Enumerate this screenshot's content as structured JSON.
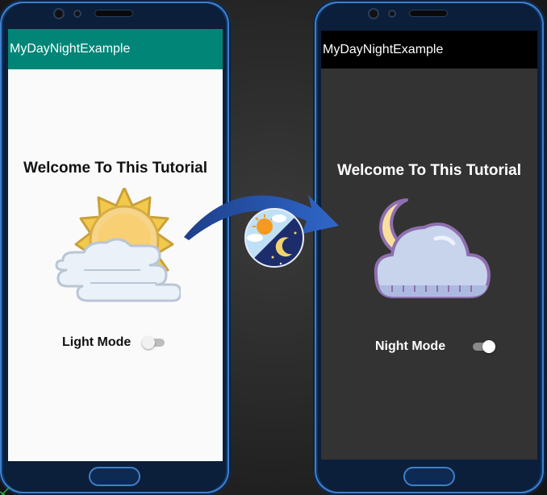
{
  "left_phone": {
    "app_title": "MyDayNightExample",
    "heading": "Welcome To This Tutorial",
    "toggle_label": "Light Mode",
    "toggle_state": "off",
    "illustration_icon": "sun-behind-cloud-icon",
    "appbar_color": "#008577"
  },
  "right_phone": {
    "app_title": "MyDayNightExample",
    "heading": "Welcome To This Tutorial",
    "toggle_label": "Night Mode",
    "toggle_state": "on",
    "illustration_icon": "moon-behind-cloud-icon",
    "appbar_color": "#000000"
  },
  "transition": {
    "arrow_icon": "curved-arrow-icon",
    "badge_icon": "day-night-icon"
  }
}
